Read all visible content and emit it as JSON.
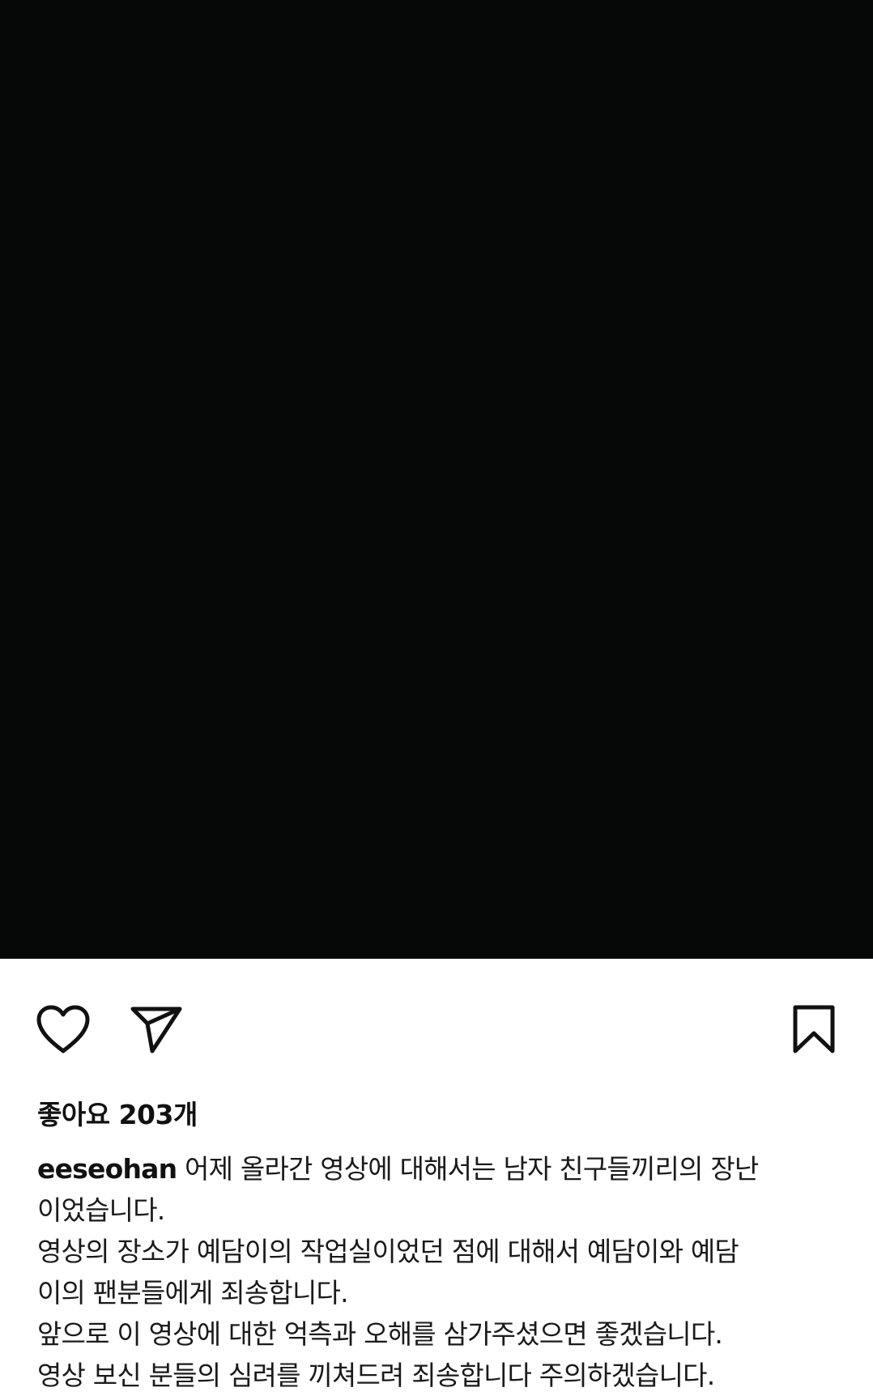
{
  "post": {
    "likes_text": "좋아요 203개",
    "username": "eeseohan",
    "caption_lines": [
      "어제 올라간 영상에 대해서는 남자 친구들끼리의 장난",
      "이었습니다.",
      "영상의 장소가 예담이의 작업실이었던 점에 대해서 예담이와 예담",
      "이의 팬분들에게 죄송합니다.",
      "앞으로 이 영상에 대한 억측과 오해를 삼가주셨으면 좋겠습니다.",
      "영상 보신 분들의 심려를 끼쳐드려 죄송합니다 주의하겠습니다."
    ]
  },
  "icons": {
    "like": "heart-icon",
    "share": "paper-plane-icon",
    "save": "bookmark-icon"
  },
  "colors": {
    "media_background": "#060707",
    "text": "#111111",
    "page_background": "#ffffff"
  }
}
